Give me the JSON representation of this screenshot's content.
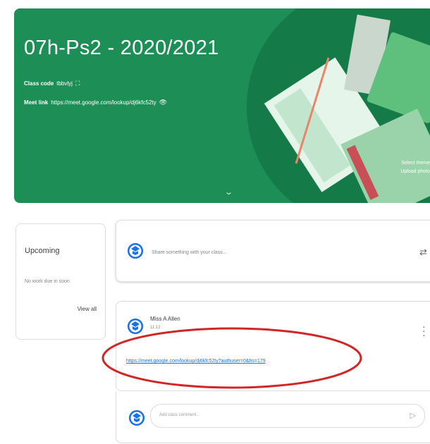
{
  "banner": {
    "class_title": "07h-Ps2 - 2020/2021",
    "class_code_label": "Class code",
    "class_code_value": "tbbvlyj",
    "meet_link_label": "Meet link",
    "meet_link_value": "https://meet.google.com/lookup/dj6kfc52ty",
    "select_theme": "Select theme",
    "upload_photo": "Upload photo",
    "colors": {
      "background": "#1e8e57",
      "accent": "#137a48"
    }
  },
  "upcoming": {
    "title": "Upcoming",
    "empty_text": "No work due in soon",
    "view_all": "View all"
  },
  "share": {
    "placeholder": "Share something with your class..."
  },
  "post": {
    "author": "Miss A Allen",
    "date": "11:12",
    "link": "https://meet.google.com/lookup/dj6kfc52ty?authuser=0&hs=179"
  },
  "comment": {
    "placeholder": "Add class comment..."
  },
  "icons": {
    "copy": "copy-icon",
    "meet": "eye-off-icon",
    "expand": "chevron-down-icon",
    "repost": "repost-icon",
    "more": "more-vert-icon",
    "send": "send-icon",
    "avatar": "classroom-avatar-icon"
  }
}
